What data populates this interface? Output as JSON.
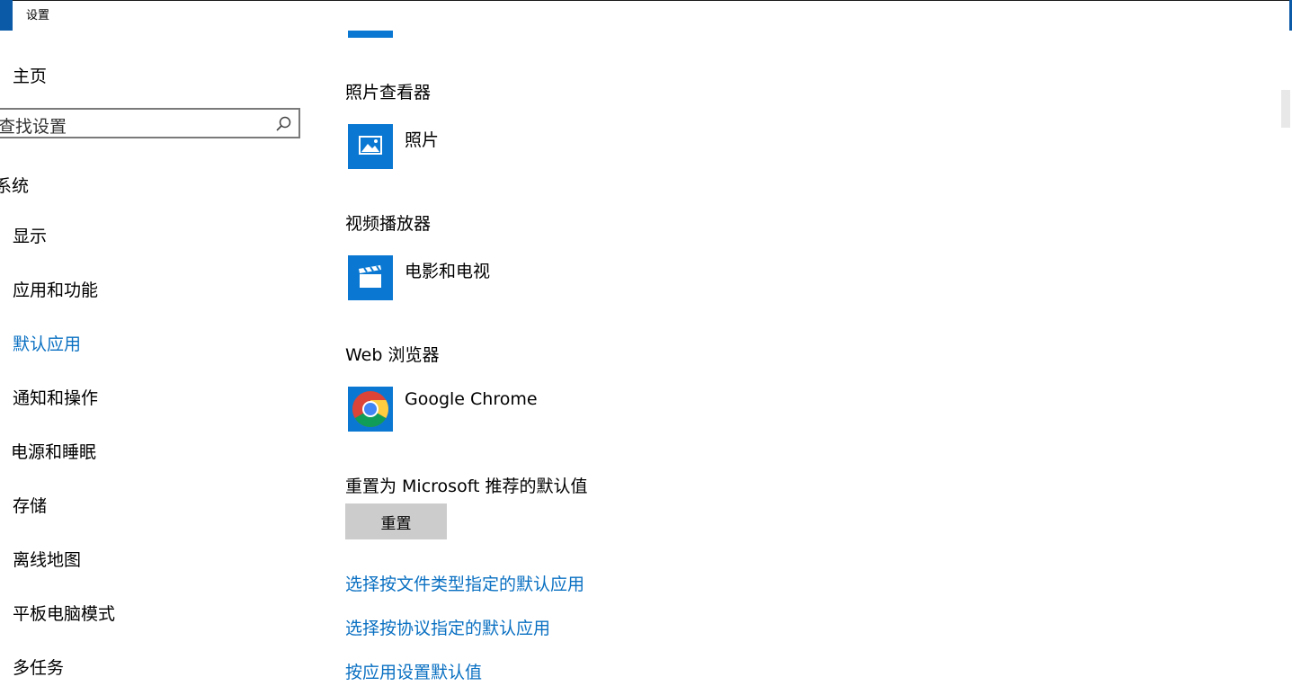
{
  "window": {
    "title": "设置"
  },
  "sidebar": {
    "home": "主页",
    "search": {
      "placeholder": "查找设置"
    },
    "section": "系统",
    "items": [
      {
        "label": "显示"
      },
      {
        "label": "应用和功能"
      },
      {
        "label": "默认应用",
        "active": true
      },
      {
        "label": "通知和操作"
      },
      {
        "label": "电源和睡眠"
      },
      {
        "label": "存储"
      },
      {
        "label": "离线地图"
      },
      {
        "label": "平板电脑模式"
      },
      {
        "label": "多任务"
      }
    ]
  },
  "main": {
    "photo_viewer": {
      "category": "照片查看器",
      "app": "照片",
      "icon": "photos-icon"
    },
    "video_player": {
      "category": "视频播放器",
      "app": "电影和电视",
      "icon": "movies-tv-icon"
    },
    "web_browser": {
      "category": "Web 浏览器",
      "app": "Google Chrome",
      "icon": "chrome-icon"
    },
    "reset": {
      "label": "重置为 Microsoft 推荐的默认值",
      "button": "重置"
    },
    "links": [
      "选择按文件类型指定的默认应用",
      "选择按协议指定的默认应用",
      "按应用设置默认值"
    ]
  },
  "colors": {
    "accent": "#0a78d2",
    "link": "#0a70c2",
    "button": "#cccccc"
  }
}
